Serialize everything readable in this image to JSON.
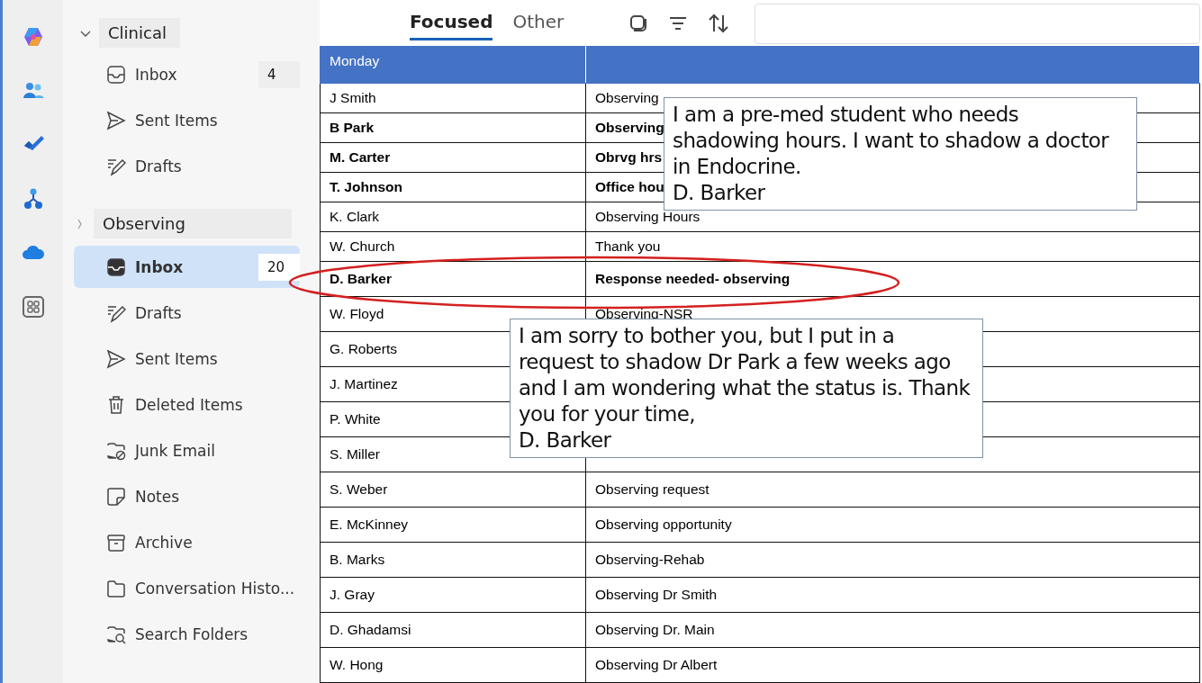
{
  "rail": [
    {
      "kind": "copilot"
    },
    {
      "kind": "people"
    },
    {
      "kind": "todo"
    },
    {
      "kind": "org"
    },
    {
      "kind": "cloud"
    },
    {
      "kind": "apps"
    }
  ],
  "folders": [
    {
      "label": "Clinical",
      "expanded": true,
      "children": [
        {
          "label": "Inbox",
          "kind": "inbox",
          "count": "4",
          "selected": false
        },
        {
          "label": "Sent Items",
          "kind": "sent",
          "selected": false
        },
        {
          "label": "Drafts",
          "kind": "drafts",
          "selected": false
        }
      ]
    },
    {
      "label": "Observing",
      "expanded": false,
      "children": [
        {
          "label": "Inbox",
          "kind": "inbox",
          "count": "20",
          "selected": true
        },
        {
          "label": "Drafts",
          "kind": "drafts",
          "selected": false
        },
        {
          "label": "Sent Items",
          "kind": "sent",
          "selected": false
        },
        {
          "label": "Deleted Items",
          "kind": "trash",
          "selected": false
        },
        {
          "label": "Junk Email",
          "kind": "junk",
          "selected": false
        },
        {
          "label": "Notes",
          "kind": "note",
          "selected": false
        },
        {
          "label": "Archive",
          "kind": "archive",
          "selected": false
        },
        {
          "label": "Conversation Histo...",
          "kind": "folder",
          "selected": false
        },
        {
          "label": "Search Folders",
          "kind": "search",
          "selected": false
        }
      ]
    }
  ],
  "tabs": [
    {
      "label": "Focused",
      "selected": true
    },
    {
      "label": "Other",
      "selected": false
    }
  ],
  "table": {
    "columns": [
      "Monday"
    ],
    "rows": [
      {
        "sender": "J Smith",
        "subject": "Observing",
        "unread": false
      },
      {
        "sender": "B Park",
        "subject": "Observing",
        "unread": true
      },
      {
        "sender": "M. Carter",
        "subject": "Obrvg hrs",
        "unread": true
      },
      {
        "sender": "T. Johnson",
        "subject": "Office hou",
        "unread": true
      },
      {
        "sender": "K. Clark",
        "subject": "Observing Hours",
        "unread": false
      },
      {
        "sender": "W. Church",
        "subject": "Thank you",
        "unread": false
      },
      {
        "sender": "D. Barker",
        "subject": "Response needed- observing",
        "unread": true
      },
      {
        "sender": "W. Floyd",
        "subject": "Observing-NSR",
        "unread": false
      },
      {
        "sender": "G. Roberts",
        "unread": false
      },
      {
        "sender": "J. Martinez",
        "unread": false
      },
      {
        "sender": "P. White",
        "unread": false
      },
      {
        "sender": "S. Miller",
        "unread": false
      },
      {
        "sender": "S. Weber",
        "subject": "Observing request",
        "unread": false
      },
      {
        "sender": "E. McKinney",
        "subject": "Observing opportunity",
        "unread": false
      },
      {
        "sender": "B. Marks",
        "subject": "Observing-Rehab",
        "unread": false
      },
      {
        "sender": "J. Gray",
        "subject": "Observing Dr Smith",
        "unread": false
      },
      {
        "sender": "D. Ghadamsi",
        "subject": "Observing Dr. Main",
        "unread": false
      },
      {
        "sender": "W. Hong",
        "subject": "Observing Dr Albert",
        "unread": false
      }
    ]
  },
  "callouts": [
    {
      "lines": [
        "I am a pre-med student who needs",
        "shadowing hours. I want to shadow a doctor",
        "in Endocrine.",
        "D. Barker"
      ]
    },
    {
      "lines": [
        "I am sorry to bother you, but I put in a",
        "request to shadow Dr Park a few weeks ago",
        "and I am wondering what the status is. Thank",
        "you for your time,",
        "D. Barker"
      ]
    }
  ]
}
